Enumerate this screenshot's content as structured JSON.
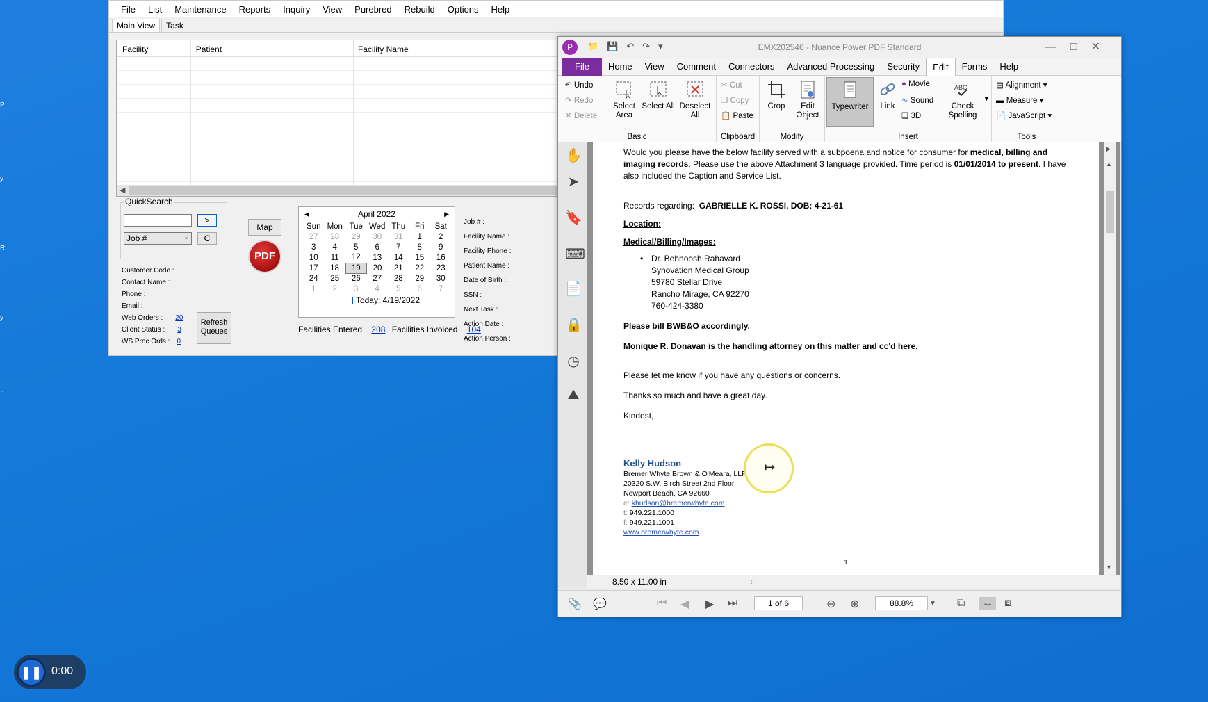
{
  "app": {
    "menu": [
      "File",
      "List",
      "Maintenance",
      "Reports",
      "Inquiry",
      "View",
      "Purebred",
      "Rebuild",
      "Options",
      "Help"
    ],
    "tabs": [
      "Main View",
      "Task"
    ],
    "grid_headers": [
      "Facility",
      "Patient",
      "Facility Name"
    ],
    "quicksearch": {
      "legend": "QuickSearch",
      "input_value": "",
      "go_label": ">",
      "select_value": "Job #",
      "clear_label": "C"
    },
    "info_labels": {
      "customer_code": "Customer Code :",
      "contact_name": "Contact Name :",
      "phone": "Phone :",
      "email": "Email :",
      "web_orders": "Web Orders :",
      "client_status": "Client Status :",
      "ws_proc_ords": "WS Proc Ords :"
    },
    "info_values": {
      "web_orders": "20",
      "client_status": "3",
      "ws_proc_ords": "0"
    },
    "refresh_label": "Refresh Queues",
    "map_label": "Map",
    "pdf_label": "PDF",
    "calendar": {
      "month": "April 2022",
      "weekdays": [
        "Sun",
        "Mon",
        "Tue",
        "Wed",
        "Thu",
        "Fri",
        "Sat"
      ],
      "weeks": [
        [
          "27",
          "28",
          "29",
          "30",
          "31",
          "1",
          "2"
        ],
        [
          "3",
          "4",
          "5",
          "6",
          "7",
          "8",
          "9"
        ],
        [
          "10",
          "11",
          "12",
          "13",
          "14",
          "15",
          "16"
        ],
        [
          "17",
          "18",
          "19",
          "20",
          "21",
          "22",
          "23"
        ],
        [
          "24",
          "25",
          "26",
          "27",
          "28",
          "29",
          "30"
        ],
        [
          "1",
          "2",
          "3",
          "4",
          "5",
          "6",
          "7"
        ]
      ],
      "selected": "19",
      "today": "Today: 4/19/2022"
    },
    "facilities_entered_label": "Facilities Entered",
    "facilities_entered": "208",
    "facilities_invoiced_label": "Facilities Invoiced",
    "facilities_invoiced": "104",
    "job_fields": [
      "Job # :",
      "Facility Name :",
      "Facility Phone :",
      "Patient Name :",
      "Date of Birth :",
      "SSN :",
      "Next Task :",
      "Action Date :",
      "Action Person :"
    ]
  },
  "pdf": {
    "title": "EMX202546 - Nuance Power PDF Standard",
    "ribbon_tabs": [
      "File",
      "Home",
      "View",
      "Comment",
      "Connectors",
      "Advanced Processing",
      "Security",
      "Edit",
      "Forms",
      "Help"
    ],
    "active_tab": "Edit",
    "basic": {
      "undo": "Undo",
      "redo": "Redo",
      "delete": "Delete",
      "select_area": "Select Area",
      "select_all": "Select All",
      "deselect_all": "Deselect All",
      "label": "Basic"
    },
    "clipboard": {
      "cut": "Cut",
      "copy": "Copy",
      "paste": "Paste",
      "label": "Clipboard"
    },
    "modify": {
      "crop": "Crop",
      "edit_object": "Edit Object",
      "label": "Modify"
    },
    "insert": {
      "typewriter": "Typewriter",
      "link": "Link",
      "movie": "Movie",
      "sound": "Sound",
      "three_d": "3D",
      "check_spelling": "Check Spelling",
      "label": "Insert"
    },
    "tools": {
      "alignment": "Alignment",
      "measure": "Measure",
      "javascript": "JavaScript",
      "label": "Tools"
    },
    "doc": {
      "p1_a": "Would you please have the below facility served with a subpoena and notice for consumer for ",
      "p1_b": "medical, billing and imaging records",
      "p1_c": ". Please use the above Attachment 3 language provided.  Time period is ",
      "p1_d": "01/01/2014 to present",
      "p1_e": ".  I have also included the Caption and Service List.",
      "records_label": "Records regarding:",
      "records_value": "GABRIELLE K. ROSSI, DOB: 4-21-61",
      "location": "Location:",
      "medical": "Medical/Billing/Images:",
      "address": [
        "Dr. Behnoosh Rahavard",
        "Synovation Medical Group",
        "59780 Stellar Drive",
        "Rancho Mirage, CA 92270",
        "760-424-3380"
      ],
      "bill": "Please bill BWB&O accordingly.",
      "attorney": "Monique R. Donavan is the handling attorney on this matter and cc'd here.",
      "questions": "Please let me know if you have any questions or concerns.",
      "thanks": "Thanks so much and have a great day.",
      "kindest": "Kindest,",
      "sig_name": "Kelly Hudson",
      "sig_firm": "Bremer Whyte Brown & O'Meara, LLP",
      "sig_street": "20320 S.W. Birch Street 2nd Floor",
      "sig_city": "Newport Beach, CA 92660",
      "sig_email_prefix": "e:",
      "sig_email": "khudson@bremerwhyte.com",
      "sig_tel_prefix": "t:",
      "sig_tel": "949.221.1000",
      "sig_fax_prefix": "f:",
      "sig_fax": "949.221.1001",
      "sig_web": "www.bremerwhyte.com",
      "page_number": "1"
    },
    "page_size": "8.50 x 11.00 in",
    "page_indicator": "1 of 6",
    "zoom": "88.8%"
  },
  "recorder": {
    "time": "0:00"
  }
}
